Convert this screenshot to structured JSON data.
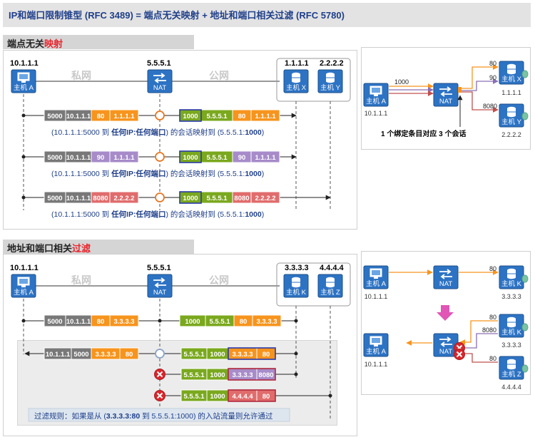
{
  "title": "IP和端口限制锥型 (RFC 3489) = 端点无关映射 + 地址和端口相关过滤 (RFC 5780)",
  "section1": {
    "title_black": "端点无关",
    "title_red": "映射",
    "ip_a": "10.1.1.1",
    "ip_nat": "5.5.5.1",
    "ip_x": "1.1.1.1",
    "ip_y": "2.2.2.2",
    "private_label": "私网",
    "public_label": "公网",
    "host_a": "主机 A",
    "nat": "NAT",
    "host_x": "主机 X",
    "host_y": "主机 Y",
    "rows": [
      {
        "left": [
          "5000",
          "10.1.1.1",
          "80",
          "1.1.1.1"
        ],
        "right": [
          "1000",
          "5.5.5.1",
          "80",
          "1.1.1.1"
        ]
      },
      {
        "left": [
          "5000",
          "10.1.1.1",
          "90",
          "1.1.1.1"
        ],
        "right": [
          "1000",
          "5.5.5.1",
          "90",
          "1.1.1.1"
        ]
      },
      {
        "left": [
          "5000",
          "10.1.1.1",
          "8080",
          "2.2.2.2"
        ],
        "right": [
          "1000",
          "5.5.5.1",
          "8080",
          "2.2.2.2"
        ]
      }
    ],
    "note_pre": "(10.1.1.1:5000 到 ",
    "note_bold": "任何IP:任何端口",
    "note_mid": ") 的会话映射到 (5.5.5.1:",
    "note_port": "1000",
    "note_end": ")"
  },
  "diagram1": {
    "host_a": "主机 A",
    "ip_a": "10.1.1.1",
    "nat": "NAT",
    "port_out": "1000",
    "host_x": "主机 X",
    "ip_x": "1.1.1.1",
    "host_y": "主机 Y",
    "ip_y": "2.2.2.2",
    "port_80": "80",
    "port_90": "90",
    "port_8080": "8080",
    "caption": "1 个绑定条目对应 3 个会话"
  },
  "section2": {
    "title_black": "地址和端口相关",
    "title_red": "过滤",
    "ip_a": "10.1.1.1",
    "ip_nat": "5.5.5.1",
    "ip_k": "3.3.3.3",
    "ip_z": "4.4.4.4",
    "private_label": "私网",
    "public_label": "公网",
    "host_a": "主机 A",
    "nat": "NAT",
    "host_k": "主机 K",
    "host_z": "主机 Z",
    "out_left": [
      "5000",
      "10.1.1.1",
      "80",
      "3.3.3.3"
    ],
    "out_right": [
      "1000",
      "5.5.5.1",
      "80",
      "3.3.3.3"
    ],
    "in_left": [
      "10.1.1.1",
      "5000",
      "3.3.3.3",
      "80"
    ],
    "in_rows": [
      [
        "5.5.5.1",
        "1000",
        "3.3.3.3",
        "80"
      ],
      [
        "5.5.5.1",
        "1000",
        "3.3.3.3",
        "8080"
      ],
      [
        "5.5.5.1",
        "1000",
        "4.4.4.4",
        "80"
      ]
    ],
    "rule_pre": "过滤规则：如果是从 (",
    "rule_bold": "3.3.3.3:80",
    "rule_end": " 到 5.5.5.1:1000) 的入站流量则允许通过"
  },
  "diagram2": {
    "host_a": "主机 A",
    "ip_a": "10.1.1.1",
    "nat": "NAT",
    "host_k": "主机 K",
    "ip_k": "3.3.3.3",
    "host_z": "主机 Z",
    "ip_z": "4.4.4.4",
    "port_80": "80",
    "port_8080": "8080"
  },
  "colors": {
    "gray": "#787878",
    "orange": "#f7941d",
    "green": "#7aa81e",
    "purple": "#a78bc9",
    "red": "#e06c6c",
    "blue": "#2b6fd6",
    "accent_red": "#e8262d"
  }
}
